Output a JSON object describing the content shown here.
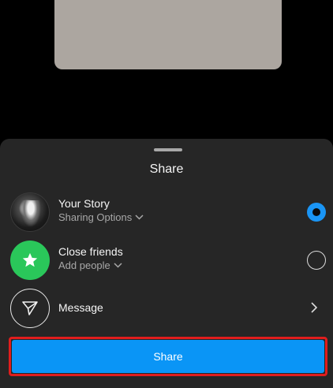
{
  "sheet": {
    "title": "Share",
    "options": [
      {
        "label": "Your Story",
        "sublabel": "Sharing Options",
        "selected": true
      },
      {
        "label": "Close friends",
        "sublabel": "Add people",
        "selected": false
      },
      {
        "label": "Message"
      }
    ],
    "share_button_label": "Share"
  },
  "colors": {
    "accent_blue": "#0a95f6",
    "close_friends_green": "#2ac75a",
    "highlight_red": "#e01d1d",
    "sheet_background": "#262626"
  },
  "icons": {
    "close_friends": "star-icon",
    "message": "paper-plane-icon",
    "sublabel_chevron": "chevron-down-icon",
    "message_chevron": "chevron-right-icon"
  }
}
